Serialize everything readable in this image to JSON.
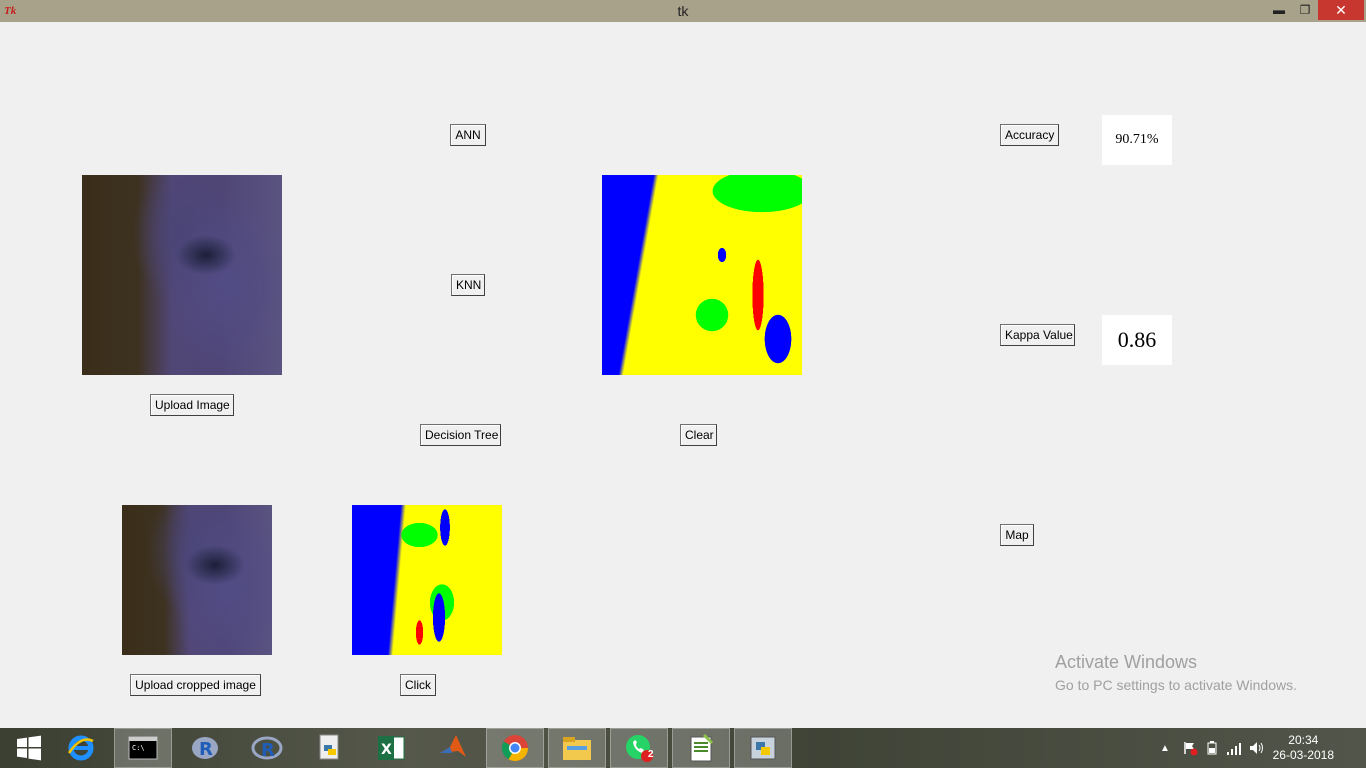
{
  "window": {
    "title": "tk",
    "min_label": "▬",
    "restore_label": "❐",
    "close_label": "✕"
  },
  "buttons": {
    "ann": "ANN",
    "knn": "KNN",
    "decision_tree": "Decision Tree",
    "clear": "Clear",
    "upload_image": "Upload Image",
    "upload_cropped": "Upload cropped image",
    "click": "Click",
    "accuracy": "Accuracy",
    "kappa": "Kappa Value",
    "map": "Map"
  },
  "values": {
    "accuracy": "90.71%",
    "kappa": "0.86"
  },
  "watermark": {
    "line1": "Activate Windows",
    "line2": "Go to PC settings to activate Windows."
  },
  "taskbar": {
    "apps": [
      "internet-explorer",
      "command-prompt",
      "r",
      "rstudio",
      "python-file",
      "excel",
      "matlab",
      "chrome",
      "file-explorer",
      "whatsapp",
      "notepad-plus",
      "python"
    ],
    "whatsapp_badge": "2",
    "time": "20:34",
    "date": "26-03-2018"
  },
  "colors": {
    "water": "#0000ff",
    "vegetation": "#00ff00",
    "urban": "#ffff00",
    "mangrove": "#ff0000"
  }
}
